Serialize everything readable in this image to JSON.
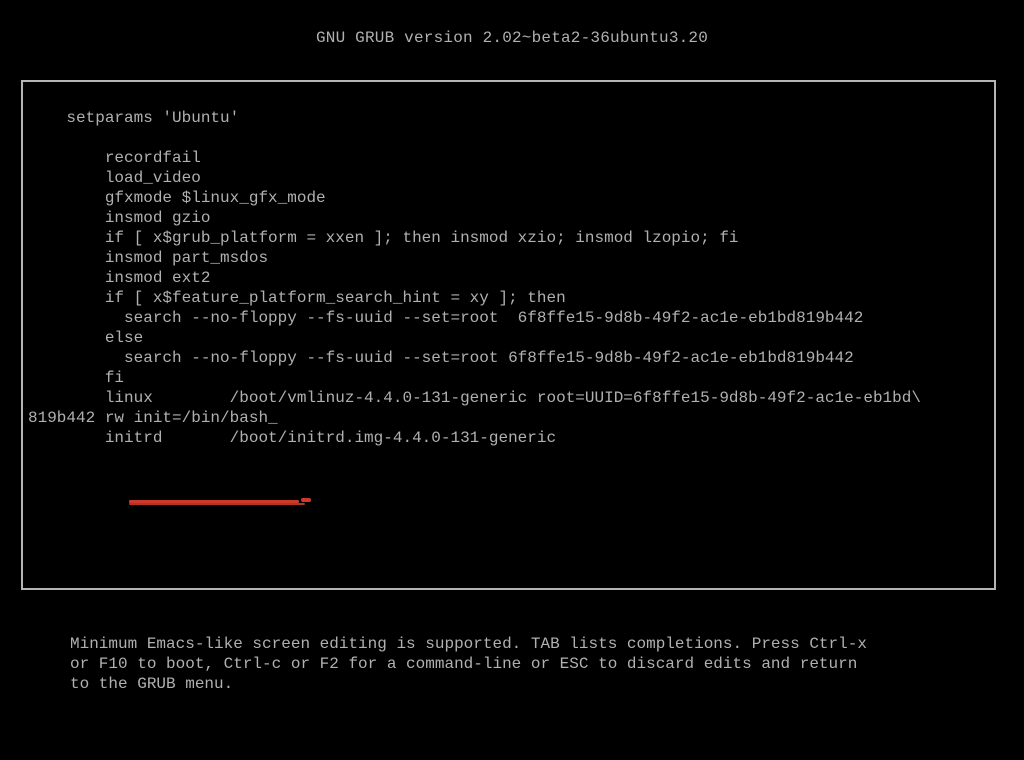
{
  "header": {
    "title": "GNU GRUB  version 2.02~beta2-36ubuntu3.20"
  },
  "editor": {
    "lines": [
      "setparams 'Ubuntu'",
      "",
      "        recordfail",
      "        load_video",
      "        gfxmode $linux_gfx_mode",
      "        insmod gzio",
      "        if [ x$grub_platform = xxen ]; then insmod xzio; insmod lzopio; fi",
      "        insmod part_msdos",
      "        insmod ext2",
      "        if [ x$feature_platform_search_hint = xy ]; then",
      "          search --no-floppy --fs-uuid --set=root  6f8ffe15-9d8b-49f2-ac1e-eb1bd819b442",
      "        else",
      "          search --no-floppy --fs-uuid --set=root 6f8ffe15-9d8b-49f2-ac1e-eb1bd819b442",
      "        fi",
      "        linux        /boot/vmlinuz-4.4.0-131-generic root=UUID=6f8ffe15-9d8b-49f2-ac1e-eb1bd\\",
      "819b442 rw init=/bin/bash_",
      "        initrd       /boot/initrd.img-4.4.0-131-generic"
    ],
    "highlight_text": "rw init=/bin/bash"
  },
  "hints": {
    "text": "Minimum Emacs-like screen editing is supported. TAB lists completions. Press Ctrl-x\nor F10 to boot, Ctrl-c or F2 for a command-line or ESC to discard edits and return\nto the GRUB menu."
  },
  "colors": {
    "fg": "#b0b0b0",
    "bg": "#000000",
    "annotation": "#cc3a2a"
  }
}
